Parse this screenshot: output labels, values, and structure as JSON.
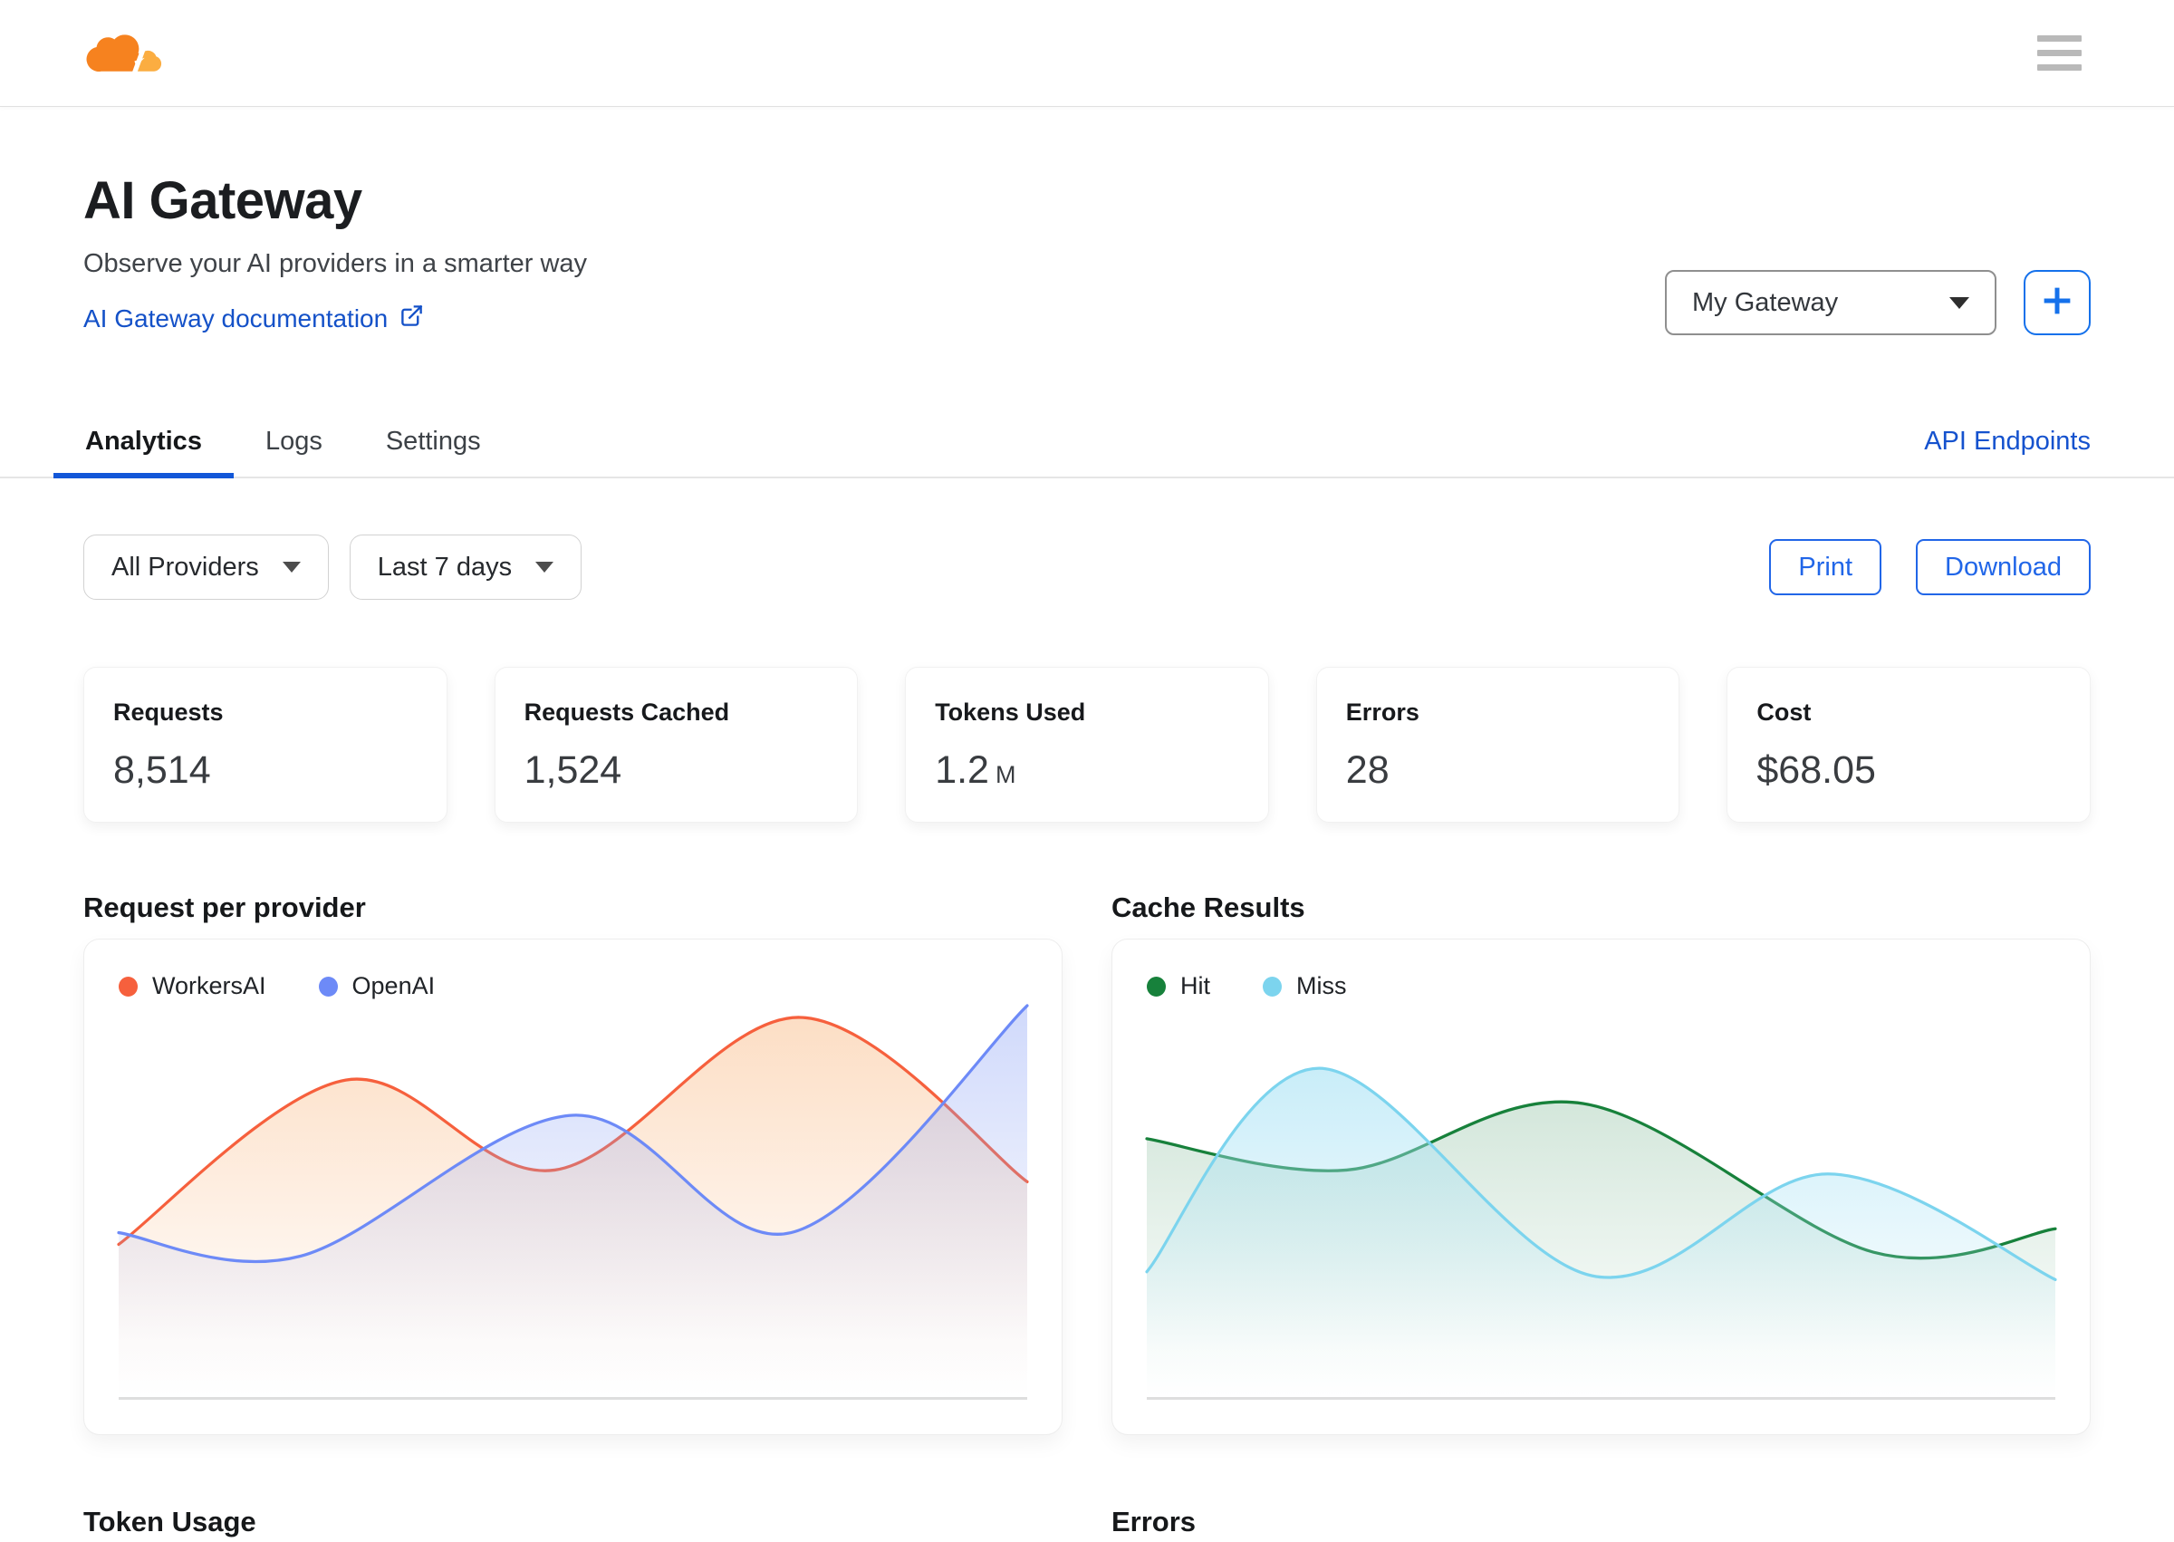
{
  "topbar": {
    "logo_icon": "cloudflare-logo",
    "menu_icon": "hamburger-menu"
  },
  "hero": {
    "title": "AI Gateway",
    "subtitle": "Observe your AI providers in a smarter way",
    "doc_link_label": "AI Gateway documentation",
    "doc_link_icon": "external-link-icon",
    "gateway_selected": "My Gateway",
    "gateway_caret_icon": "caret-down-icon",
    "add_gateway_icon": "plus-icon"
  },
  "tabs": {
    "items": [
      {
        "label": "Analytics",
        "active": true
      },
      {
        "label": "Logs",
        "active": false
      },
      {
        "label": "Settings",
        "active": false
      }
    ],
    "api_endpoints_label": "API Endpoints"
  },
  "filters": {
    "providers": "All Providers",
    "date_range": "Last 7 days"
  },
  "actions": {
    "print_label": "Print",
    "download_label": "Download"
  },
  "stats": [
    {
      "label": "Requests",
      "value": "8,514",
      "suffix": ""
    },
    {
      "label": "Requests Cached",
      "value": "1,524",
      "suffix": ""
    },
    {
      "label": "Tokens Used",
      "value": "1.2",
      "suffix": "M"
    },
    {
      "label": "Errors",
      "value": "28",
      "suffix": ""
    },
    {
      "label": "Cost",
      "value": "$68.05",
      "suffix": ""
    }
  ],
  "sections": {
    "token_usage_title": "Token Usage",
    "errors_title": "Errors"
  },
  "colors": {
    "accent_blue": "#2166E8",
    "link_blue": "#1451C8",
    "tab_underline_blue": "#1257D8",
    "brand_orange": "#F6821F",
    "brand_orange_light": "#FBAD41"
  },
  "chart_data": [
    {
      "type": "area",
      "title": "Request per provider",
      "xlabel": "",
      "ylabel": "",
      "ylim": [
        0,
        100
      ],
      "grid": false,
      "axes_visible": false,
      "legend_position": "top-left",
      "series": [
        {
          "name": "WorkersAI",
          "color": "#F6603D",
          "fill": "#F79B4E",
          "fill_opacity": 0.33,
          "x": [
            0,
            25,
            48,
            75,
            100
          ],
          "y": [
            39,
            81,
            58,
            97,
            55
          ]
        },
        {
          "name": "OpenAI",
          "color": "#6D8AF7",
          "fill": "#8FA5F5",
          "fill_opacity": 0.42,
          "x": [
            0,
            20,
            50,
            74,
            100
          ],
          "y": [
            42,
            36,
            72,
            42,
            100
          ]
        }
      ]
    },
    {
      "type": "area",
      "title": "Cache Results",
      "xlabel": "",
      "ylabel": "",
      "ylim": [
        0,
        100
      ],
      "grid": false,
      "axes_visible": false,
      "legend_position": "top-left",
      "series": [
        {
          "name": "Hit",
          "color": "#17813B",
          "fill": "#63A87E",
          "fill_opacity": 0.28,
          "x": [
            0,
            22,
            48,
            80,
            100
          ],
          "y": [
            66,
            58,
            75,
            37,
            43
          ]
        },
        {
          "name": "Miss",
          "color": "#7CD4EE",
          "fill": "#A5E1F4",
          "fill_opacity": 0.6,
          "x": [
            0,
            19,
            49,
            75,
            100
          ],
          "y": [
            32,
            84,
            31,
            57,
            30
          ]
        }
      ]
    }
  ]
}
